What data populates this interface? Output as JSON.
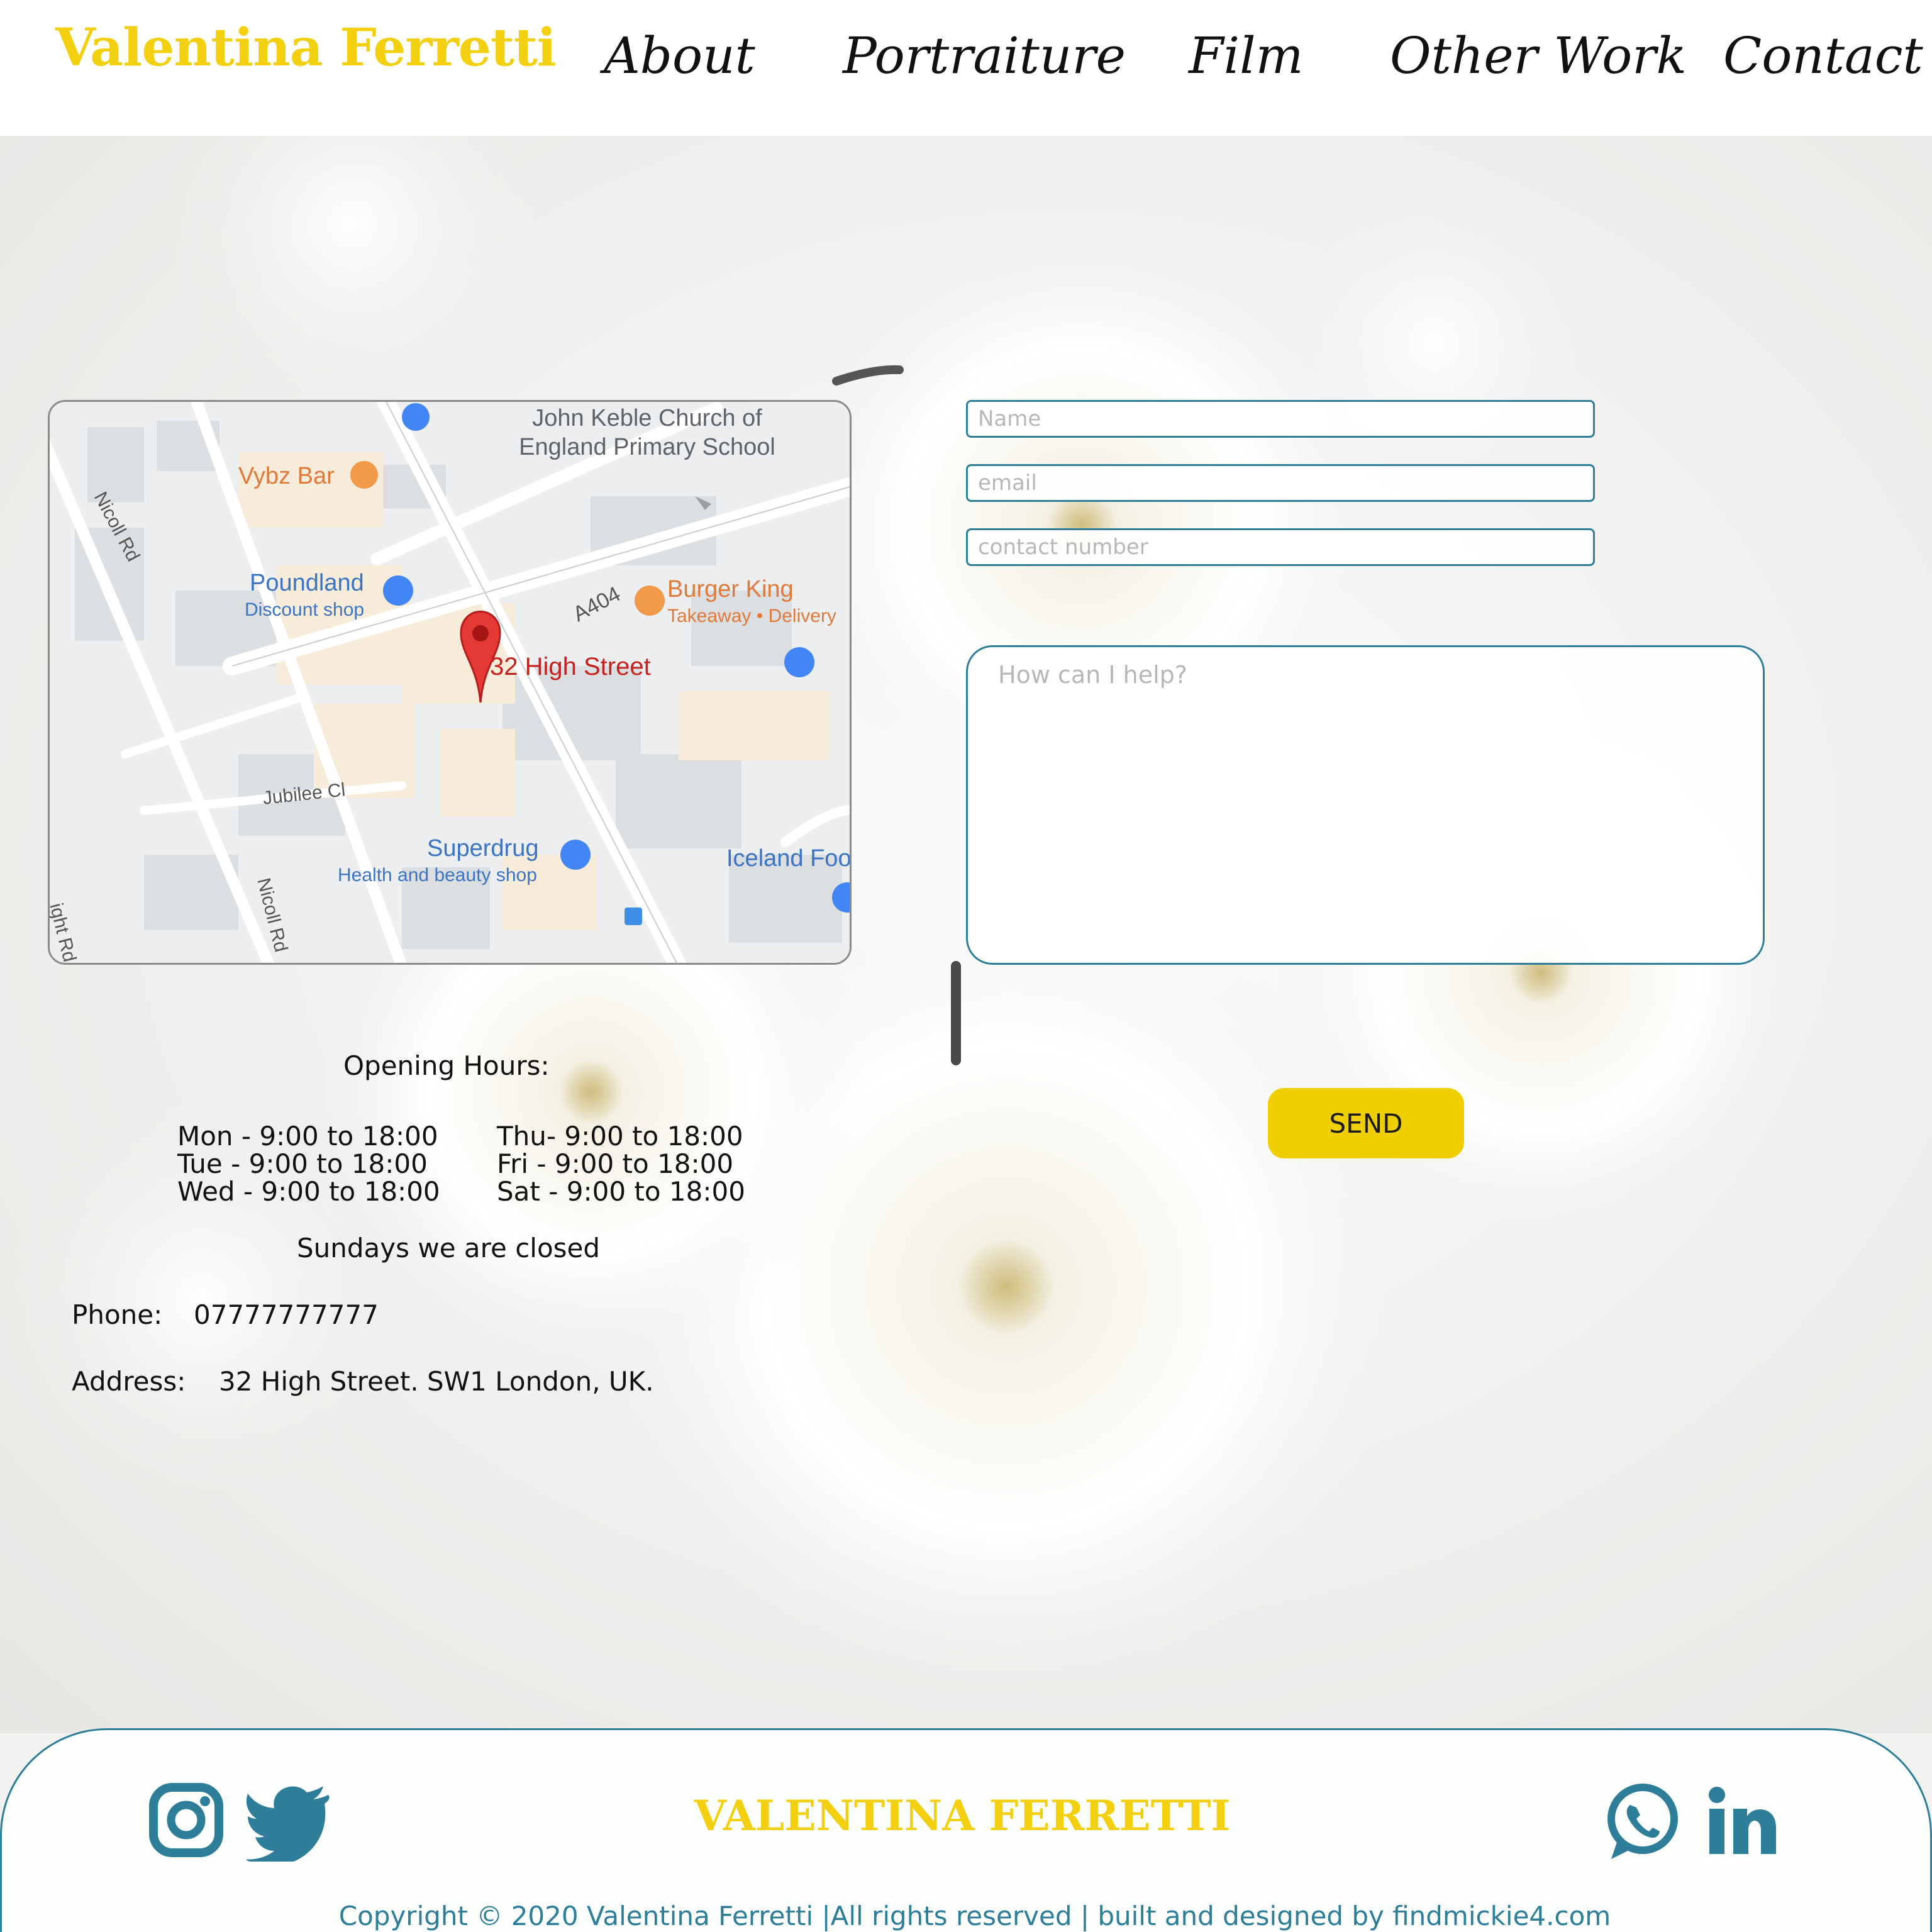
{
  "header": {
    "brand": "Valentina Ferretti",
    "nav": [
      "About",
      "Portraiture",
      "Film",
      "Other Work",
      "Contact"
    ]
  },
  "map": {
    "pin_label": "32 High Street",
    "places": {
      "school_line1": "John Keble Church of",
      "school_line2": "England Primary School",
      "vybz": "Vybz Bar",
      "poundland": "Poundland",
      "poundland_sub": "Discount shop",
      "burger_king": "Burger King",
      "burger_king_sub": "Takeaway • Delivery",
      "superdrug": "Superdrug",
      "superdrug_sub": "Health and beauty shop",
      "iceland": "Iceland Foo"
    },
    "roads": {
      "a404": "A404",
      "nicoll_top": "Nicoll Rd",
      "nicoll_bottom": "Nicoll Rd",
      "jubilee": "Jubilee Cl",
      "edge": "ight Rd"
    }
  },
  "form": {
    "name_placeholder": "Name",
    "email_placeholder": "email",
    "phone_placeholder": "contact number",
    "message_placeholder": "How can I help?",
    "send_label": "SEND"
  },
  "info": {
    "hours_title": "Opening Hours:",
    "hours_left": [
      "Mon - 9:00 to 18:00",
      "Tue - 9:00 to 18:00",
      "Wed - 9:00 to 18:00"
    ],
    "hours_right": [
      "Thu- 9:00 to 18:00",
      "Fri - 9:00 to 18:00",
      "Sat - 9:00 to 18:00"
    ],
    "closed_note": "Sundays we are closed",
    "phone_label": "Phone:",
    "phone_value": "07777777777",
    "address_label": "Address:",
    "address_value": "32 High Street. SW1  London, UK."
  },
  "footer": {
    "brand": "VALENTINA FERRETTI",
    "copyright": "Copyright © 2020 Valentina Ferretti |All rights reserved | built and designed by findmickie4.com",
    "social_icons": [
      "instagram-icon",
      "twitter-icon",
      "whatsapp-icon",
      "linkedin-icon"
    ]
  },
  "colors": {
    "brand_yellow": "#f2cf0f",
    "button_yellow": "#f0cf00",
    "accent_teal": "#2f7e99",
    "pin_red": "#e53935"
  }
}
